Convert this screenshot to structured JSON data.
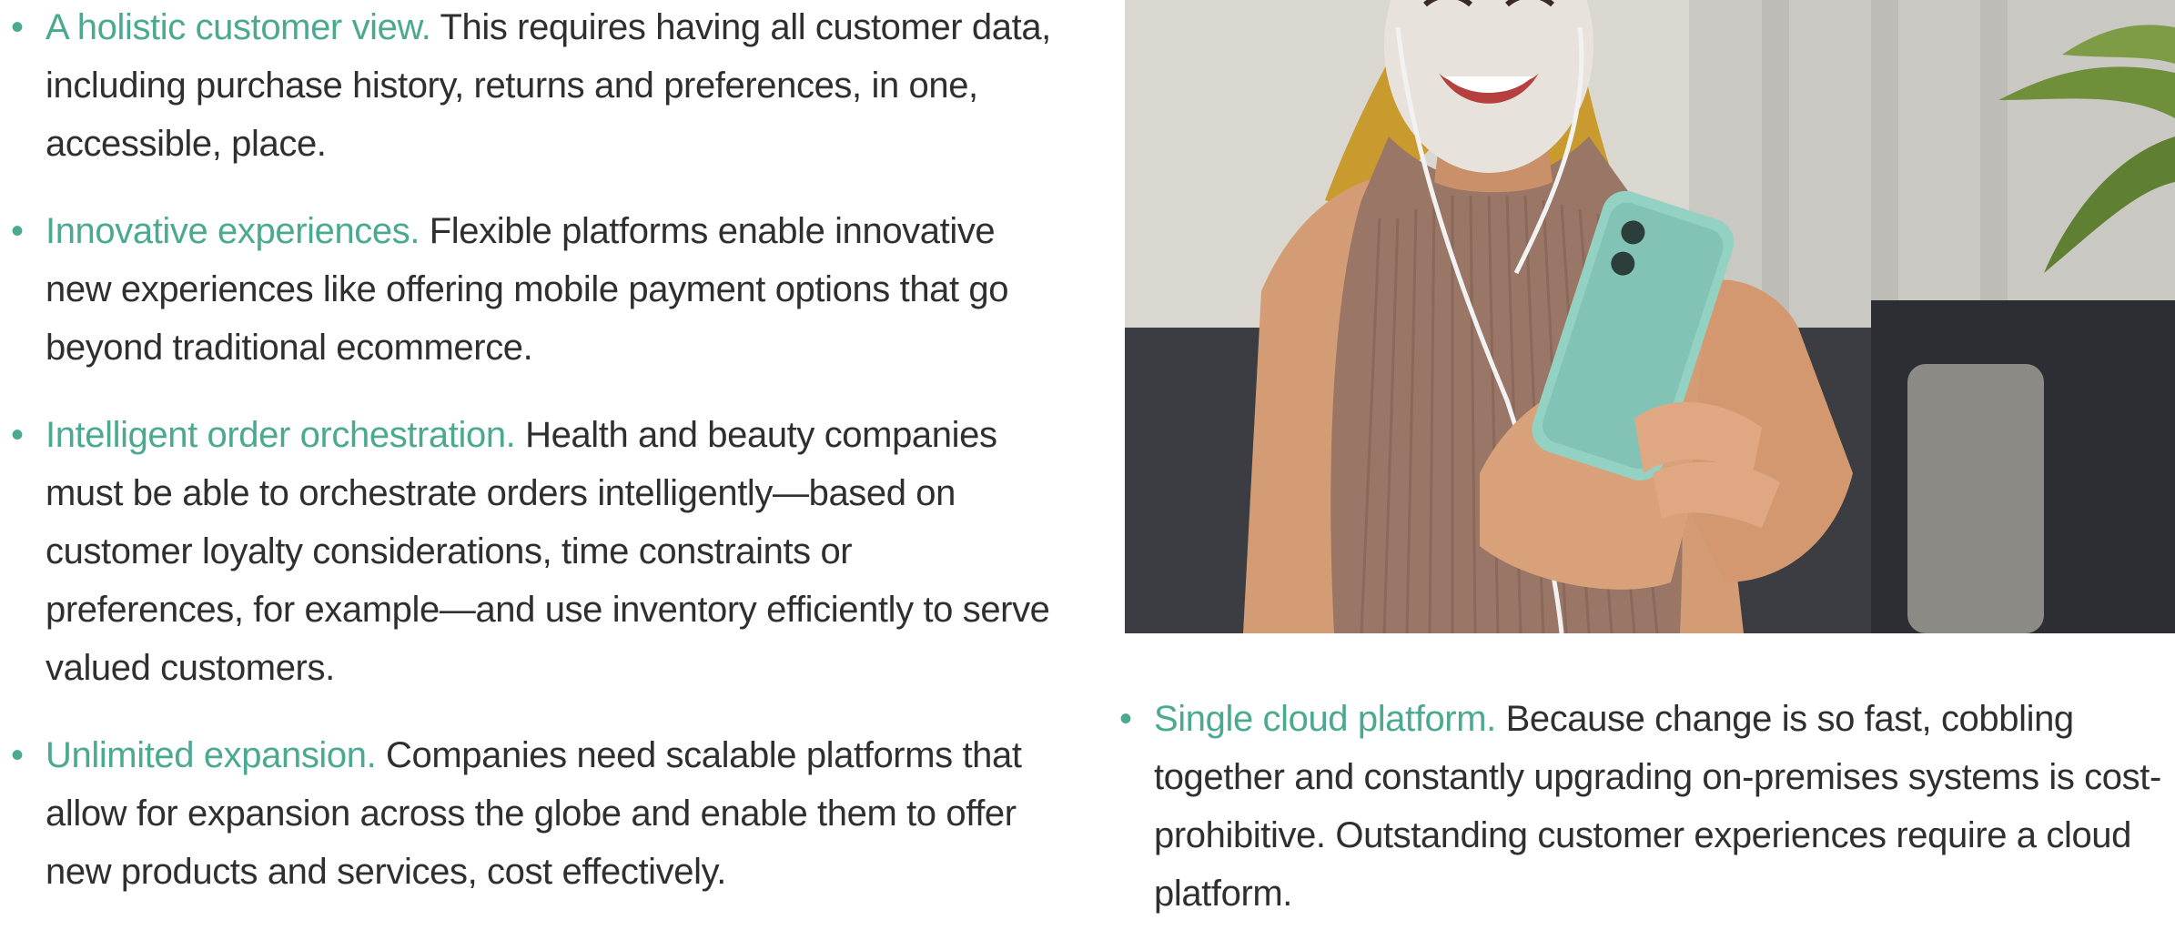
{
  "left_items": [
    {
      "lead": "A holistic customer view.",
      "text": " This requires having all customer data, including purchase history, returns and preferences, in one, accessible, place."
    },
    {
      "lead": "Innovative experiences.",
      "text": " Flexible platforms enable innovative new experiences like offering mobile payment options that go beyond traditional ecommerce."
    },
    {
      "lead": "Intelligent order orchestration.",
      "text": " Health and beauty companies must be able to orchestrate orders intelligently—based on customer loyalty considerations, time constraints or preferences, for example—and use inventory efficiently to serve valued customers."
    },
    {
      "lead": "Unlimited expansion.",
      "text": " Companies need scalable platforms that allow for expansion across the globe and enable them to offer new products and services, cost effectively."
    }
  ],
  "right_items": [
    {
      "lead": "Single cloud platform.",
      "text": " Because change is so fast, cobbling together and constantly upgrading on-premises systems is cost-prohibitive. Outstanding customer experiences require a cloud platform."
    }
  ],
  "bullet_char": "•",
  "colors": {
    "accent": "#4ba992",
    "body_text": "#2f2f2f"
  }
}
